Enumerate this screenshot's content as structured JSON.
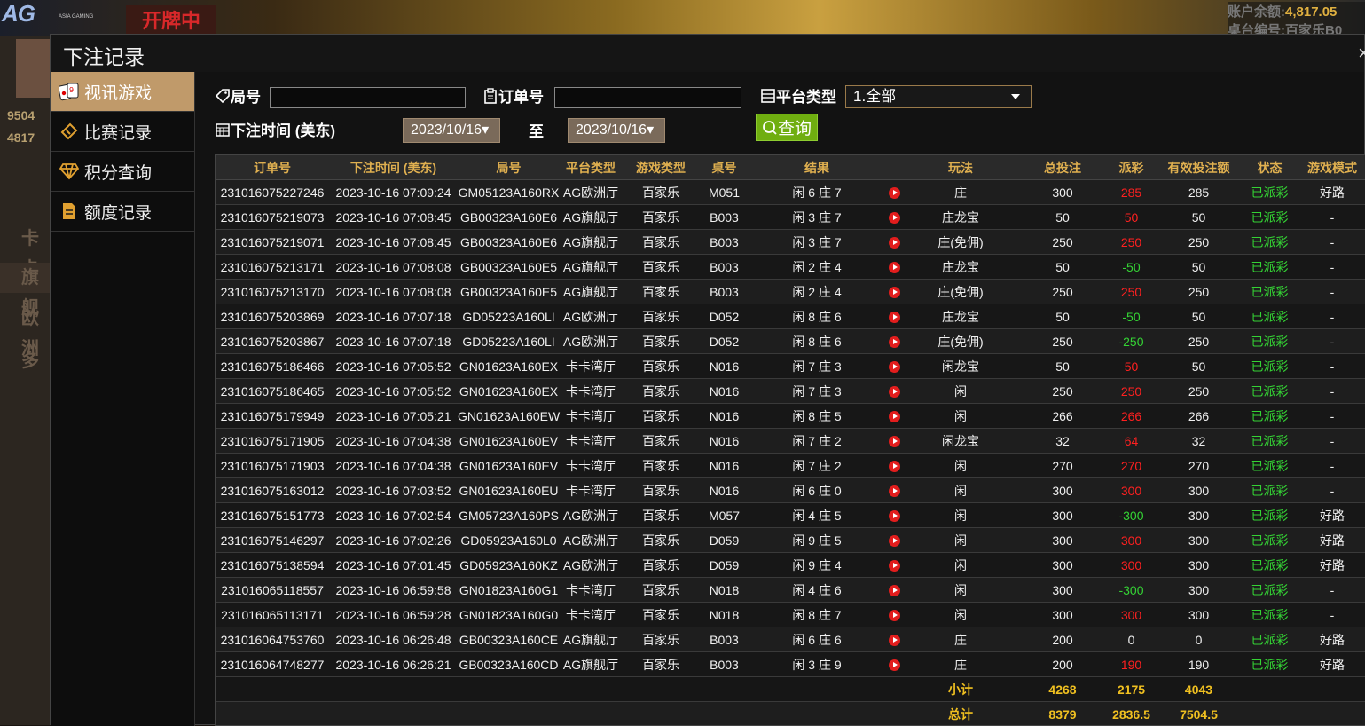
{
  "background": {
    "logo": "AG",
    "logo_sub": "ASIA GAMING",
    "status_banner": "开牌中",
    "balance_label": "账户余额:",
    "balance_value": "4,817.05",
    "table_label": "桌台编号:",
    "table_value": "百家乐B0",
    "side_num_1": "9504",
    "side_num_2": "4817",
    "side_items": [
      "卡卡",
      "旗舰",
      "欧洲",
      "多"
    ]
  },
  "modal": {
    "title": "下注记录",
    "close": "×"
  },
  "sidebar": {
    "items": [
      {
        "label": "视讯游戏",
        "icon": "cards-icon",
        "active": true
      },
      {
        "label": "比赛记录",
        "icon": "ticket-icon",
        "active": false
      },
      {
        "label": "积分查询",
        "icon": "diamond-icon",
        "active": false
      },
      {
        "label": "额度记录",
        "icon": "document-icon",
        "active": false
      }
    ]
  },
  "filters": {
    "round_label": "局号",
    "round_value": "",
    "order_label": "订单号",
    "order_value": "",
    "platform_label": "平台类型",
    "platform_selected": "1.全部",
    "time_label": "下注时间 (美东)",
    "date_from": "2023/10/16",
    "to_label": "至",
    "date_to": "2023/10/16",
    "query_label": "查询"
  },
  "table": {
    "headers": [
      "订单号",
      "下注时间 (美东)",
      "局号",
      "平台类型",
      "游戏类型",
      "桌号",
      "结果",
      "",
      "玩法",
      "总投注",
      "派彩",
      "有效投注额",
      "状态",
      "游戏模式"
    ],
    "rows": [
      [
        "231016075227246",
        "2023-10-16 07:09:24",
        "GM05123A160RX",
        "AG欧洲厅",
        "百家乐",
        "M051",
        "闲 6 庄 7",
        "庄",
        "300",
        "285",
        "285",
        "已派彩",
        "好路",
        "red"
      ],
      [
        "231016075219073",
        "2023-10-16 07:08:45",
        "GB00323A160E6",
        "AG旗舰厅",
        "百家乐",
        "B003",
        "闲 3 庄 7",
        "庄龙宝",
        "50",
        "50",
        "50",
        "已派彩",
        "-",
        "red"
      ],
      [
        "231016075219071",
        "2023-10-16 07:08:45",
        "GB00323A160E6",
        "AG旗舰厅",
        "百家乐",
        "B003",
        "闲 3 庄 7",
        "庄(免佣)",
        "250",
        "250",
        "250",
        "已派彩",
        "-",
        "red"
      ],
      [
        "231016075213171",
        "2023-10-16 07:08:08",
        "GB00323A160E5",
        "AG旗舰厅",
        "百家乐",
        "B003",
        "闲 2 庄 4",
        "庄龙宝",
        "50",
        "-50",
        "50",
        "已派彩",
        "-",
        "green"
      ],
      [
        "231016075213170",
        "2023-10-16 07:08:08",
        "GB00323A160E5",
        "AG旗舰厅",
        "百家乐",
        "B003",
        "闲 2 庄 4",
        "庄(免佣)",
        "250",
        "250",
        "250",
        "已派彩",
        "-",
        "red"
      ],
      [
        "231016075203869",
        "2023-10-16 07:07:18",
        "GD05223A160LI",
        "AG欧洲厅",
        "百家乐",
        "D052",
        "闲 8 庄 6",
        "庄龙宝",
        "50",
        "-50",
        "50",
        "已派彩",
        "-",
        "green"
      ],
      [
        "231016075203867",
        "2023-10-16 07:07:18",
        "GD05223A160LI",
        "AG欧洲厅",
        "百家乐",
        "D052",
        "闲 8 庄 6",
        "庄(免佣)",
        "250",
        "-250",
        "250",
        "已派彩",
        "-",
        "green"
      ],
      [
        "231016075186466",
        "2023-10-16 07:05:52",
        "GN01623A160EX",
        "卡卡湾厅",
        "百家乐",
        "N016",
        "闲 7 庄 3",
        "闲龙宝",
        "50",
        "50",
        "50",
        "已派彩",
        "-",
        "red"
      ],
      [
        "231016075186465",
        "2023-10-16 07:05:52",
        "GN01623A160EX",
        "卡卡湾厅",
        "百家乐",
        "N016",
        "闲 7 庄 3",
        "闲",
        "250",
        "250",
        "250",
        "已派彩",
        "-",
        "red"
      ],
      [
        "231016075179949",
        "2023-10-16 07:05:21",
        "GN01623A160EW",
        "卡卡湾厅",
        "百家乐",
        "N016",
        "闲 8 庄 5",
        "闲",
        "266",
        "266",
        "266",
        "已派彩",
        "-",
        "red"
      ],
      [
        "231016075171905",
        "2023-10-16 07:04:38",
        "GN01623A160EV",
        "卡卡湾厅",
        "百家乐",
        "N016",
        "闲 7 庄 2",
        "闲龙宝",
        "32",
        "64",
        "32",
        "已派彩",
        "-",
        "red"
      ],
      [
        "231016075171903",
        "2023-10-16 07:04:38",
        "GN01623A160EV",
        "卡卡湾厅",
        "百家乐",
        "N016",
        "闲 7 庄 2",
        "闲",
        "270",
        "270",
        "270",
        "已派彩",
        "-",
        "red"
      ],
      [
        "231016075163012",
        "2023-10-16 07:03:52",
        "GN01623A160EU",
        "卡卡湾厅",
        "百家乐",
        "N016",
        "闲 6 庄 0",
        "闲",
        "300",
        "300",
        "300",
        "已派彩",
        "-",
        "red"
      ],
      [
        "231016075151773",
        "2023-10-16 07:02:54",
        "GM05723A160PS",
        "AG欧洲厅",
        "百家乐",
        "M057",
        "闲 4 庄 5",
        "闲",
        "300",
        "-300",
        "300",
        "已派彩",
        "好路",
        "green"
      ],
      [
        "231016075146297",
        "2023-10-16 07:02:26",
        "GD05923A160L0",
        "AG欧洲厅",
        "百家乐",
        "D059",
        "闲 9 庄 5",
        "闲",
        "300",
        "300",
        "300",
        "已派彩",
        "好路",
        "red"
      ],
      [
        "231016075138594",
        "2023-10-16 07:01:45",
        "GD05923A160KZ",
        "AG欧洲厅",
        "百家乐",
        "D059",
        "闲 9 庄 4",
        "闲",
        "300",
        "300",
        "300",
        "已派彩",
        "好路",
        "red"
      ],
      [
        "231016065118557",
        "2023-10-16 06:59:58",
        "GN01823A160G1",
        "卡卡湾厅",
        "百家乐",
        "N018",
        "闲 4 庄 6",
        "闲",
        "300",
        "-300",
        "300",
        "已派彩",
        "-",
        "green"
      ],
      [
        "231016065113171",
        "2023-10-16 06:59:28",
        "GN01823A160G0",
        "卡卡湾厅",
        "百家乐",
        "N018",
        "闲 8 庄 7",
        "闲",
        "300",
        "300",
        "300",
        "已派彩",
        "-",
        "red"
      ],
      [
        "231016064753760",
        "2023-10-16 06:26:48",
        "GB00323A160CE",
        "AG旗舰厅",
        "百家乐",
        "B003",
        "闲 6 庄 6",
        "庄",
        "200",
        "0",
        "0",
        "已派彩",
        "好路",
        "white"
      ],
      [
        "231016064748277",
        "2023-10-16 06:26:21",
        "GB00323A160CD",
        "AG旗舰厅",
        "百家乐",
        "B003",
        "闲 3 庄 9",
        "庄",
        "200",
        "190",
        "190",
        "已派彩",
        "好路",
        "red"
      ]
    ],
    "subtotal": {
      "label": "小计",
      "bet": "4268",
      "payout": "2175",
      "valid": "4043"
    },
    "total": {
      "label": "总计",
      "bet": "8379",
      "payout": "2836.5",
      "valid": "7504.5"
    }
  }
}
